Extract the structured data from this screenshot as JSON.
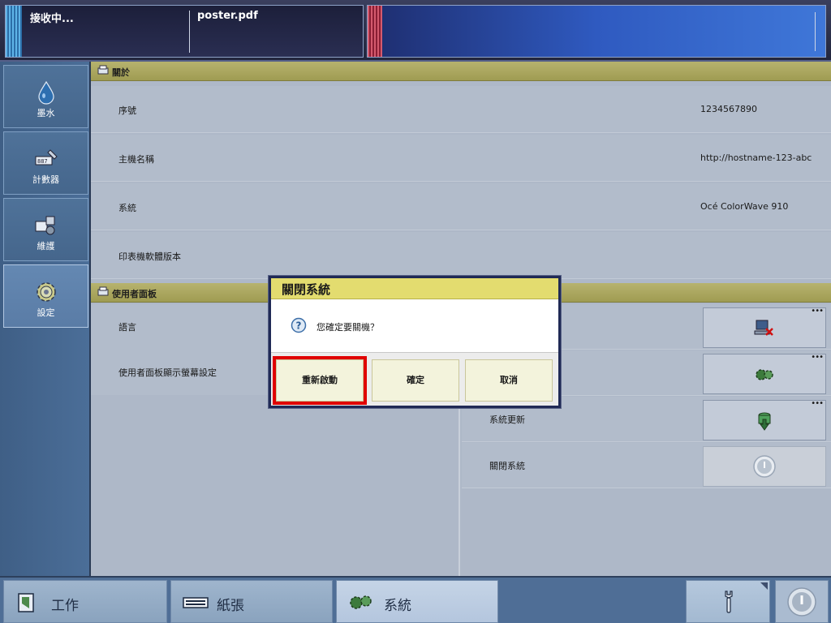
{
  "status": {
    "job_state": "接收中...",
    "file_name": "poster.pdf"
  },
  "sidebar": {
    "items": [
      {
        "label": "墨水",
        "icon": "ink-drop-icon"
      },
      {
        "label": "計數器",
        "icon": "counter-icon"
      },
      {
        "label": "維護",
        "icon": "maintenance-icon"
      },
      {
        "label": "設定",
        "icon": "settings-gear-icon",
        "active": true
      }
    ]
  },
  "about": {
    "header": "關於",
    "rows": [
      {
        "label": "序號",
        "value": "1234567890"
      },
      {
        "label": "主機名稱",
        "value": "http://hostname-123-abc"
      },
      {
        "label": "系統",
        "value": "Océ ColorWave 910"
      },
      {
        "label": "印表機軟體版本",
        "value": ""
      }
    ]
  },
  "panel": {
    "header": "使用者面板",
    "rows": [
      {
        "label": "語言"
      },
      {
        "label": "使用者面板顯示螢幕設定"
      }
    ]
  },
  "system": {
    "rows": [
      {
        "label": "",
        "icon": "remote-disconnect-icon"
      },
      {
        "label": "",
        "icon": "gears-icon"
      },
      {
        "label": "系統更新",
        "icon": "system-update-icon"
      },
      {
        "label": "關閉系統",
        "icon": "power-icon",
        "disabled": true
      }
    ]
  },
  "dialog": {
    "title": "關閉系統",
    "message": "您確定要關機？",
    "buttons": {
      "restart": "重新啟動",
      "confirm": "確定",
      "cancel": "取消"
    }
  },
  "bottom_nav": {
    "tabs": [
      {
        "label": "工作",
        "icon": "job-icon"
      },
      {
        "label": "紙張",
        "icon": "paper-icon"
      },
      {
        "label": "系統",
        "icon": "system-gears-icon",
        "active": true
      }
    ],
    "tool_icon": "wrench-icon",
    "power_icon": "power-icon"
  },
  "colors": {
    "accent_header": "#9f9c52",
    "dialog_title": "#e3dc6f",
    "highlight_red": "#e00000"
  }
}
